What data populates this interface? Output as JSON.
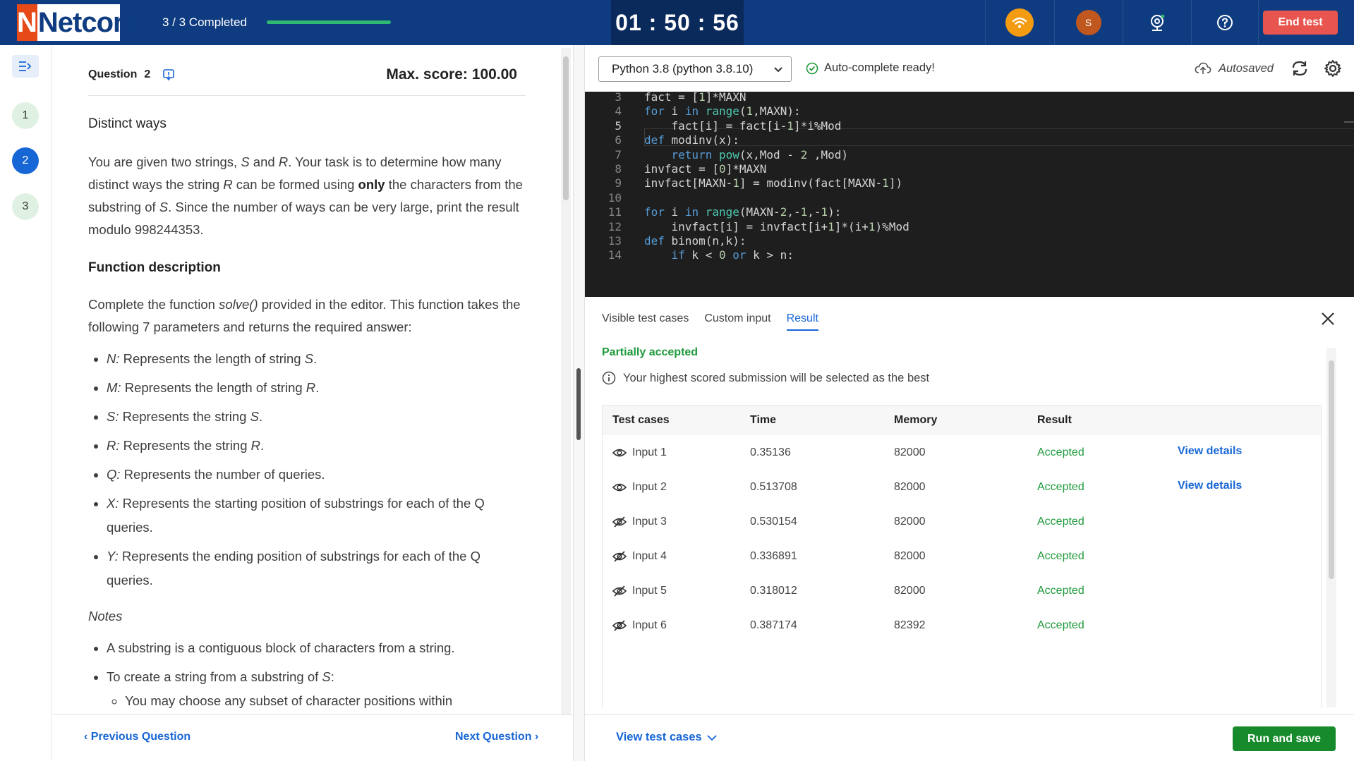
{
  "header": {
    "logo_text": "Netcore",
    "logo_mark": "N",
    "progress_label": "3 / 3 Completed",
    "progress_fraction": 1.0,
    "timer": "01 : 50 : 56",
    "avatar_initial": "S",
    "end_test_label": "End test",
    "icons": [
      "wifi-icon",
      "avatar",
      "webcam-icon",
      "help-icon"
    ]
  },
  "rail": {
    "questions": [
      {
        "label": "1",
        "state": "done"
      },
      {
        "label": "2",
        "state": "active"
      },
      {
        "label": "3",
        "state": "done"
      }
    ]
  },
  "question": {
    "label": "Question",
    "number": "2",
    "max_score": "Max. score: 100.00",
    "title": "Distinct ways",
    "intro_1": "You are given two strings, ",
    "intro_S": "S",
    "intro_2": " and ",
    "intro_R": "R",
    "intro_3": ". Your task is to determine how many distinct ways the string ",
    "intro_R2": "R",
    "intro_4": " can be formed using ",
    "intro_only": "only",
    "intro_5": " the characters from the substring of ",
    "intro_S2": "S",
    "intro_6": ". Since the number of ways can be very large, print the result modulo 998244353.",
    "func_heading": "Function description",
    "func_1": "Complete the function ",
    "func_name": "solve()",
    "func_2": " provided in the editor. This function takes the following 7 parameters and returns the required answer:",
    "params": [
      {
        "name": "N:",
        "desc": " Represents the length of string ",
        "var": "S",
        "end": "."
      },
      {
        "name": "M:",
        "desc": " Represents the length of string ",
        "var": "R",
        "end": "."
      },
      {
        "name": "S:",
        "desc": " Represents the string ",
        "var": "S",
        "end": "."
      },
      {
        "name": "R:",
        "desc": " Represents the string ",
        "var": "R",
        "end": "."
      },
      {
        "name": "Q:",
        "desc": " Represents the number of queries.",
        "var": "",
        "end": ""
      },
      {
        "name": "X:",
        "desc": " Represents the starting position of substrings for each of the Q queries.",
        "var": "",
        "end": ""
      },
      {
        "name": "Y:",
        "desc": " Represents the ending position of substrings for each of the Q queries.",
        "var": "",
        "end": ""
      }
    ],
    "notes_heading": "Notes",
    "note_1": "A substring is a contiguous block of characters from a string.",
    "note_2a": "To create a string from a substring of ",
    "note_2b": "S",
    "note_2c": ":",
    "note_2_sub": "You may choose any subset of character positions within",
    "prev_label": "Previous Question",
    "next_label": "Next Question"
  },
  "editor": {
    "language": "Python 3.8 (python 3.8.10)",
    "autocomplete": "Auto-complete ready!",
    "autosaved": "Autosaved",
    "lines": [
      {
        "n": "3",
        "html": "fact = [1]*MAXN"
      },
      {
        "n": "4",
        "html": "for i in range(1,MAXN):"
      },
      {
        "n": "5",
        "html": "    fact[i] = fact[i-1]*i%Mod"
      },
      {
        "n": "6",
        "html": "def modinv(x):"
      },
      {
        "n": "7",
        "html": "    return pow(x,Mod - 2 ,Mod)"
      },
      {
        "n": "8",
        "html": "invfact = [0]*MAXN"
      },
      {
        "n": "9",
        "html": "invfact[MAXN-1] = modinv(fact[MAXN-1])"
      },
      {
        "n": "10",
        "html": ""
      },
      {
        "n": "11",
        "html": "for i in range(MAXN-2,-1,-1):"
      },
      {
        "n": "12",
        "html": "    invfact[i] = invfact[i+1]*(i+1)%Mod"
      },
      {
        "n": "13",
        "html": "def binom(n,k):"
      },
      {
        "n": "14",
        "html": "    if k < 0 or k > n:"
      }
    ]
  },
  "results": {
    "tabs": [
      "Visible test cases",
      "Custom input",
      "Result"
    ],
    "active_tab": "Result",
    "status": "Partially accepted",
    "hint": "Your highest scored submission will be selected as the best",
    "columns": [
      "Test cases",
      "Time",
      "Memory",
      "Result"
    ],
    "rows": [
      {
        "name": "Input 1",
        "time": "0.35136",
        "memory": "82000",
        "result": "Accepted",
        "visible": true,
        "link": "View details"
      },
      {
        "name": "Input 2",
        "time": "0.513708",
        "memory": "82000",
        "result": "Accepted",
        "visible": true,
        "link": "View details"
      },
      {
        "name": "Input 3",
        "time": "0.530154",
        "memory": "82000",
        "result": "Accepted",
        "visible": false,
        "link": ""
      },
      {
        "name": "Input 4",
        "time": "0.336891",
        "memory": "82000",
        "result": "Accepted",
        "visible": false,
        "link": ""
      },
      {
        "name": "Input 5",
        "time": "0.318012",
        "memory": "82000",
        "result": "Accepted",
        "visible": false,
        "link": ""
      },
      {
        "name": "Input 6",
        "time": "0.387174",
        "memory": "82392",
        "result": "Accepted",
        "visible": false,
        "link": ""
      }
    ],
    "view_test_cases": "View test cases",
    "run_label": "Run and save"
  },
  "colors": {
    "header_bg": "#0f3c80",
    "accent_blue": "#1766d6",
    "success_green": "#1f9a3c",
    "danger_red": "#e8554e"
  }
}
